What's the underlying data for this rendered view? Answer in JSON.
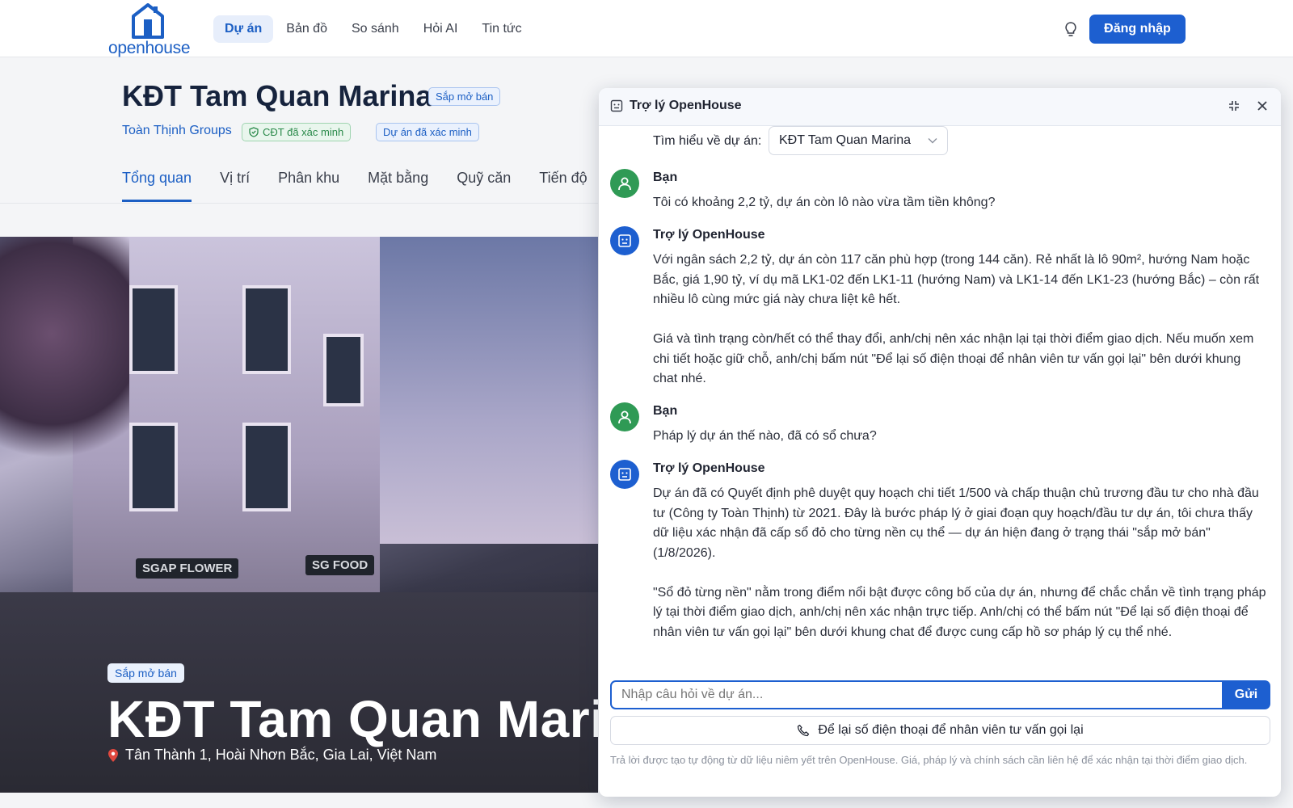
{
  "header": {
    "logo_text": "openhouse",
    "nav": [
      "Dự án",
      "Bản đồ",
      "So sánh",
      "Hỏi AI",
      "Tin tức"
    ],
    "active_nav": "Dự án",
    "login_label": "Đăng nhập"
  },
  "project": {
    "title": "KĐT Tam Quan Marina",
    "status_badge": "Sắp mở bán",
    "developer": "Toàn Thịnh Groups",
    "badge_cdt": "CĐT đã xác minh",
    "badge_verified": "Dự án đã xác minh",
    "tabs": [
      "Tổng quan",
      "Vị trí",
      "Phân khu",
      "Mặt bằng",
      "Quỹ căn",
      "Tiến độ"
    ],
    "active_tab": "Tổng quan"
  },
  "hero": {
    "badge": "Sắp mở bán",
    "title": "KĐT Tam Quan Marina",
    "address": "Tân Thành 1, Hoài Nhơn Bắc, Gia Lai, Việt Nam",
    "sign_left": "SGAP FLOWER",
    "sign_right": "SG FOOD"
  },
  "chat": {
    "title": "Trợ lý OpenHouse",
    "project_pick_label": "Tìm hiểu về dự án:",
    "project_pick_value": "KĐT Tam Quan Marina",
    "messages": [
      {
        "role": "user",
        "author": "Bạn",
        "paragraphs": [
          "Tôi có khoảng 2,2 tỷ, dự án còn lô nào vừa tầm tiền không?"
        ]
      },
      {
        "role": "bot",
        "author": "Trợ lý OpenHouse",
        "paragraphs": [
          "Với ngân sách 2,2 tỷ, dự án còn 117 căn phù hợp (trong 144 căn). Rẻ nhất là lô 90m², hướng Nam hoặc Bắc, giá 1,90 tỷ, ví dụ mã LK1-02 đến LK1-11 (hướng Nam) và LK1-14 đến LK1-23 (hướng Bắc) – còn rất nhiều lô cùng mức giá này chưa liệt kê hết.",
          "Giá và tình trạng còn/hết có thể thay đổi, anh/chị nên xác nhận lại tại thời điểm giao dịch. Nếu muốn xem chi tiết hoặc giữ chỗ, anh/chị bấm nút \"Để lại số điện thoại để nhân viên tư vấn gọi lại\" bên dưới khung chat nhé."
        ]
      },
      {
        "role": "user",
        "author": "Bạn",
        "paragraphs": [
          "Pháp lý dự án thế nào, đã có sổ chưa?"
        ]
      },
      {
        "role": "bot",
        "author": "Trợ lý OpenHouse",
        "paragraphs": [
          "Dự án đã có Quyết định phê duyệt quy hoạch chi tiết 1/500 và chấp thuận chủ trương đầu tư cho nhà đầu tư (Công ty Toàn Thịnh) từ 2021. Đây là bước pháp lý ở giai đoạn quy hoạch/đầu tư dự án, tôi chưa thấy dữ liệu xác nhận đã cấp sổ đỏ cho từng nền cụ thể — dự án hiện đang ở trạng thái \"sắp mở bán\" (1/8/2026).",
          "\"Sổ đỏ từng nền\" nằm trong điểm nổi bật được công bố của dự án, nhưng để chắc chắn về tình trạng pháp lý tại thời điểm giao dịch, anh/chị nên xác nhận trực tiếp. Anh/chị có thể bấm nút \"Để lại số điện thoại để nhân viên tư vấn gọi lại\" bên dưới khung chat để được cung cấp hồ sơ pháp lý cụ thể nhé."
        ]
      }
    ],
    "input_placeholder": "Nhập câu hỏi về dự án...",
    "send_label": "Gửi",
    "callback_label": "Để lại số điện thoại để nhân viên tư vấn gọi lại",
    "disclaimer": "Trả lời được tạo tự động từ dữ liệu niêm yết trên OpenHouse. Giá, pháp lý và chính sách cần liên hệ để xác nhận tại thời điểm giao dịch."
  },
  "icons": {
    "logo": "house-logo-icon",
    "theme": "lightbulb-icon",
    "cdt": "shield-check-icon",
    "location": "map-pin-icon",
    "chat": "robot-icon",
    "collapse": "collapse-icon",
    "close": "close-icon",
    "dropdown": "chevron-down-icon",
    "phone": "phone-icon"
  },
  "colors": {
    "primary": "#1d5fd0",
    "user_avatar": "#2f9a55",
    "verified_green": "#2a8a4a"
  }
}
